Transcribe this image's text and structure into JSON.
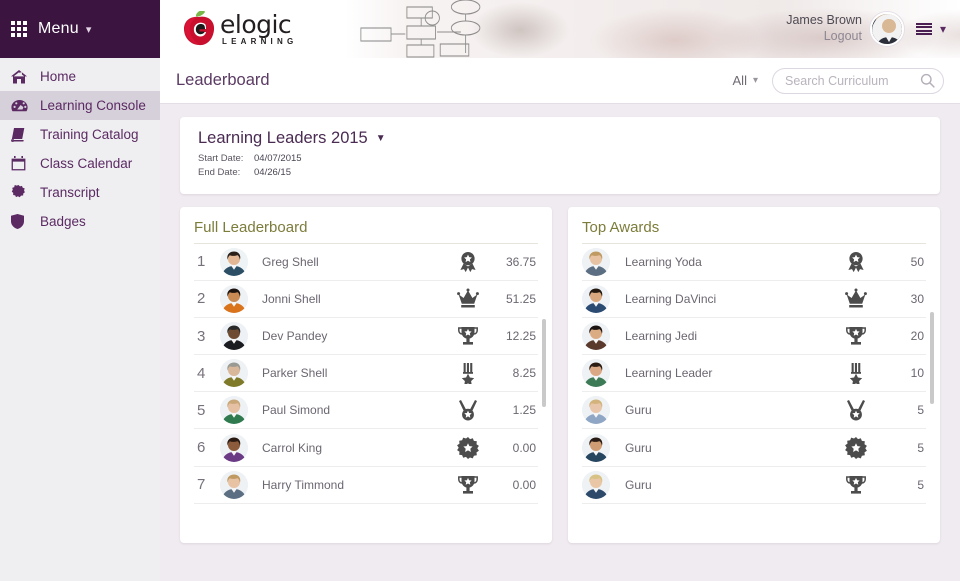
{
  "sidebar": {
    "menu_label": "Menu",
    "menu_icon": "grid-icon",
    "items": [
      {
        "label": "Home",
        "icon": "home-icon",
        "active": false
      },
      {
        "label": "Learning Console",
        "icon": "dashboard-icon",
        "active": true
      },
      {
        "label": "Training Catalog",
        "icon": "book-icon",
        "active": false
      },
      {
        "label": "Class Calendar",
        "icon": "calendar-icon",
        "active": false
      },
      {
        "label": "Transcript",
        "icon": "certificate-seal-icon",
        "active": false
      },
      {
        "label": "Badges",
        "icon": "shield-icon",
        "active": false
      }
    ]
  },
  "header": {
    "logo_word": "elogic",
    "logo_sub": "LEARNING",
    "logo_icon": "apple-logo-icon",
    "user_name": "James Brown",
    "logout_label": "Logout",
    "avatar_icon": "user-avatar",
    "list_menu_icon": "list-menu-icon",
    "list_caret_icon": "chevron-down-icon"
  },
  "subbar": {
    "page_title": "Leaderboard",
    "filter_label": "All",
    "filter_caret_icon": "chevron-down-icon",
    "search_placeholder": "Search Curriculum",
    "search_value": "",
    "search_icon": "search-icon"
  },
  "leaders_card": {
    "title": "Learning Leaders 2015",
    "caret_icon": "caret-down-icon",
    "start_label": "Start Date:",
    "start_value": "04/07/2015",
    "end_label": "End Date:",
    "end_value": "04/26/15"
  },
  "full_leaderboard": {
    "title": "Full Leaderboard",
    "rows": [
      {
        "rank": "1",
        "name": "Greg Shell",
        "icon": "award-ribbon-icon",
        "score": "36.75"
      },
      {
        "rank": "2",
        "name": "Jonni Shell",
        "icon": "crown-icon",
        "score": "51.25"
      },
      {
        "rank": "3",
        "name": "Dev Pandey",
        "icon": "trophy-star-icon",
        "score": "12.25"
      },
      {
        "rank": "4",
        "name": "Parker Shell",
        "icon": "medal-ribbon-icon",
        "score": "8.25"
      },
      {
        "rank": "5",
        "name": "Paul Simond",
        "icon": "medal-circle-icon",
        "score": "1.25"
      },
      {
        "rank": "6",
        "name": "Carrol King",
        "icon": "starburst-icon",
        "score": "0.00"
      },
      {
        "rank": "7",
        "name": "Harry Timmond",
        "icon": "trophy-star-icon",
        "score": "0.00"
      }
    ]
  },
  "top_awards": {
    "title": "Top Awards",
    "rows": [
      {
        "name": "Learning Yoda",
        "icon": "award-ribbon-icon",
        "score": "50"
      },
      {
        "name": "Learning DaVinci",
        "icon": "crown-icon",
        "score": "30"
      },
      {
        "name": "Learning Jedi",
        "icon": "trophy-star-icon",
        "score": "20"
      },
      {
        "name": "Learning Leader",
        "icon": "medal-ribbon-icon",
        "score": "10"
      },
      {
        "name": "Guru",
        "icon": "medal-circle-icon",
        "score": "5"
      },
      {
        "name": "Guru",
        "icon": "starburst-icon",
        "score": "5"
      },
      {
        "name": "Guru",
        "icon": "trophy-star-icon",
        "score": "5"
      }
    ]
  },
  "colors": {
    "brand_purple": "#3b1440",
    "nav_purple": "#5b2a63",
    "panel_title_olive": "#7c7c3b",
    "page_bg": "#f0ebf0",
    "sidebar_bg": "#efeff1"
  }
}
